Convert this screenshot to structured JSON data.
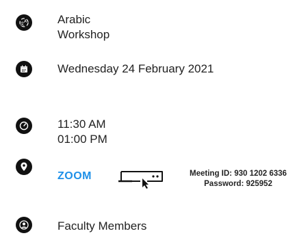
{
  "event": {
    "title_line1": "Arabic",
    "title_line2": "Workshop",
    "date": "Wednesday 24 February 2021",
    "start_time": "11:30 AM",
    "end_time": "01:00 PM",
    "location": {
      "label": "ZOOM",
      "meeting_id": "Meeting ID: 930 1202 6336",
      "password": "Password: 925952"
    },
    "audience": "Faculty Members"
  },
  "colors": {
    "link": "#1e90e8",
    "icon_bg": "#111111",
    "text": "#222222"
  },
  "icons": {
    "language": "translate-icon",
    "date": "calendar-icon",
    "time": "clock-icon",
    "location": "map-pin-icon",
    "meeting_device": "laptop-click-icon",
    "audience": "user-icon"
  }
}
